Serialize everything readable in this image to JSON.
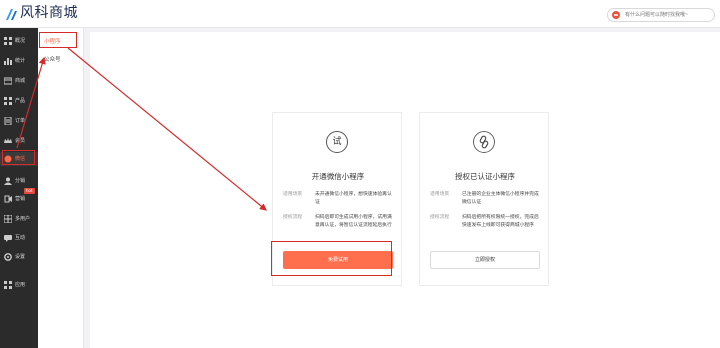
{
  "header": {
    "brand": "风科商城",
    "search_placeholder": "有什么问题可以随时找我哦~"
  },
  "colors": {
    "accent": "#ff6f4d",
    "nav_bg": "#2b2b2b",
    "annotation": "#d42a2a"
  },
  "nav": {
    "items": [
      {
        "label": "概况",
        "icon": "overview-icon"
      },
      {
        "label": "统计",
        "icon": "stats-icon"
      },
      {
        "label": "商城",
        "icon": "store-icon"
      },
      {
        "label": "产品",
        "icon": "product-icon"
      },
      {
        "label": "订单",
        "icon": "order-icon"
      },
      {
        "label": "会员",
        "icon": "member-icon"
      },
      {
        "label": "微信",
        "icon": "wechat-icon"
      },
      {
        "label": "分销",
        "icon": "distribution-icon"
      },
      {
        "label": "营销",
        "icon": "marketing-icon"
      },
      {
        "label": "多用户",
        "icon": "multiuser-icon"
      },
      {
        "label": "互动",
        "icon": "interaction-icon"
      },
      {
        "label": "设置",
        "icon": "settings-icon"
      },
      {
        "label": "应用",
        "icon": "apps-icon"
      }
    ],
    "hot_badge": "hot"
  },
  "subnav": {
    "items": [
      {
        "label": "小程序"
      },
      {
        "label": "公众号"
      }
    ]
  },
  "cards": {
    "trial": {
      "icon_text": "试",
      "title": "开通微信小程序",
      "row1_label": "适用场景",
      "row1_value": "未开通微信小程序，想快速体验再认证",
      "row2_label": "授权流程",
      "row2_value": "扫码后即可生成试用小程序，试用满意再认证，将暂信认证流程延后执行",
      "button": "免费试用"
    },
    "authorize": {
      "icon": "link-icon",
      "title": "授权已认证小程序",
      "row1_label": "适用场景",
      "row1_value": "已注册的企业主体微信小程序并完成微信认证",
      "row2_label": "授权流程",
      "row2_value": "扫码后把所有权限统一授权，完成后快速发布上线即可获得商城小程序",
      "button": "立即授权"
    }
  }
}
